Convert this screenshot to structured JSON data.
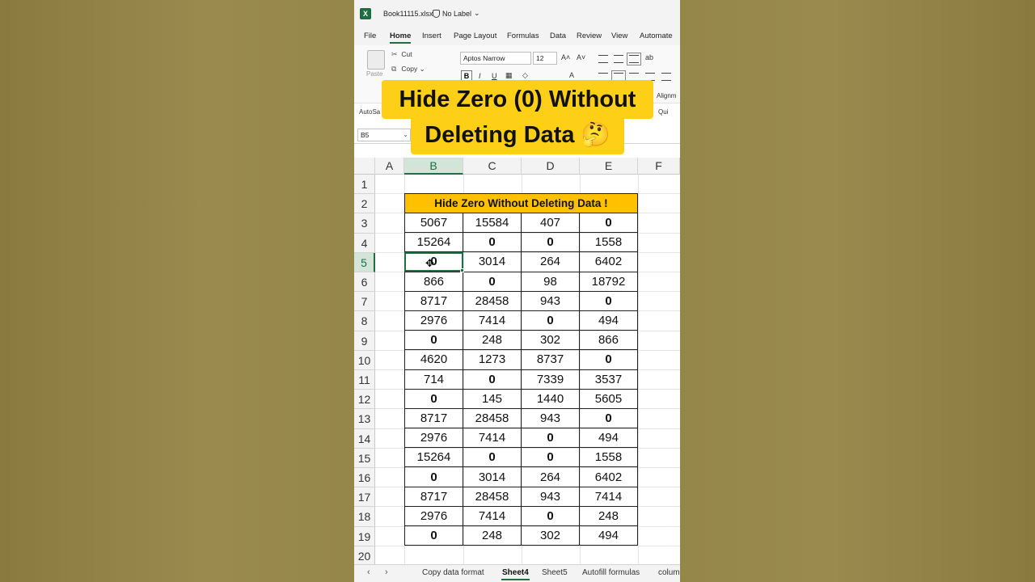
{
  "window": {
    "filename": "Book11115.xlsx",
    "label": "No Label"
  },
  "menu": [
    "File",
    "Home",
    "Insert",
    "Page Layout",
    "Formulas",
    "Data",
    "Review",
    "View",
    "Automate"
  ],
  "ribbon": {
    "paste": "Paste",
    "cut": "Cut",
    "copy": "Copy",
    "font": "Aptos Narrow",
    "size": "12",
    "bold": "B",
    "italic": "I",
    "underline": "U",
    "autosave": "AutoSa",
    "alignment": "Alignm",
    "quick": "Qui"
  },
  "formula_bar": {
    "name_box": "B5"
  },
  "banner": {
    "line1": "Hide Zero (0) Without",
    "line2": "Deleting Data 🤔"
  },
  "grid": {
    "columns": [
      "A",
      "B",
      "C",
      "D",
      "E",
      "F"
    ],
    "rows": [
      "1",
      "2",
      "3",
      "4",
      "5",
      "6",
      "7",
      "8",
      "9",
      "10",
      "11",
      "12",
      "13",
      "14",
      "15",
      "16",
      "17",
      "18",
      "19",
      "20"
    ],
    "selected_column": "B",
    "selected_row": "5"
  },
  "table": {
    "header": "Hide Zero Without Deleting Data !",
    "rows": [
      [
        "5067",
        "15584",
        "407",
        "0"
      ],
      [
        "15264",
        "0",
        "0",
        "1558"
      ],
      [
        "0",
        "3014",
        "264",
        "6402"
      ],
      [
        "866",
        "0",
        "98",
        "18792"
      ],
      [
        "8717",
        "28458",
        "943",
        "0"
      ],
      [
        "2976",
        "7414",
        "0",
        "494"
      ],
      [
        "0",
        "248",
        "302",
        "866"
      ],
      [
        "4620",
        "1273",
        "8737",
        "0"
      ],
      [
        "714",
        "0",
        "7339",
        "3537"
      ],
      [
        "0",
        "145",
        "1440",
        "5605"
      ],
      [
        "8717",
        "28458",
        "943",
        "0"
      ],
      [
        "2976",
        "7414",
        "0",
        "494"
      ],
      [
        "15264",
        "0",
        "0",
        "1558"
      ],
      [
        "0",
        "3014",
        "264",
        "6402"
      ],
      [
        "8717",
        "28458",
        "943",
        "7414"
      ],
      [
        "2976",
        "7414",
        "0",
        "248"
      ],
      [
        "0",
        "248",
        "302",
        "494"
      ]
    ]
  },
  "sheet_tabs": [
    "Copy data format",
    "Sheet4",
    "Sheet5",
    "Autofill formulas",
    "colum"
  ],
  "active_sheet": "Sheet4",
  "colors": {
    "accent": "#1d6f42",
    "header_fill": "#ffc000",
    "banner_fill": "#fdd017"
  }
}
